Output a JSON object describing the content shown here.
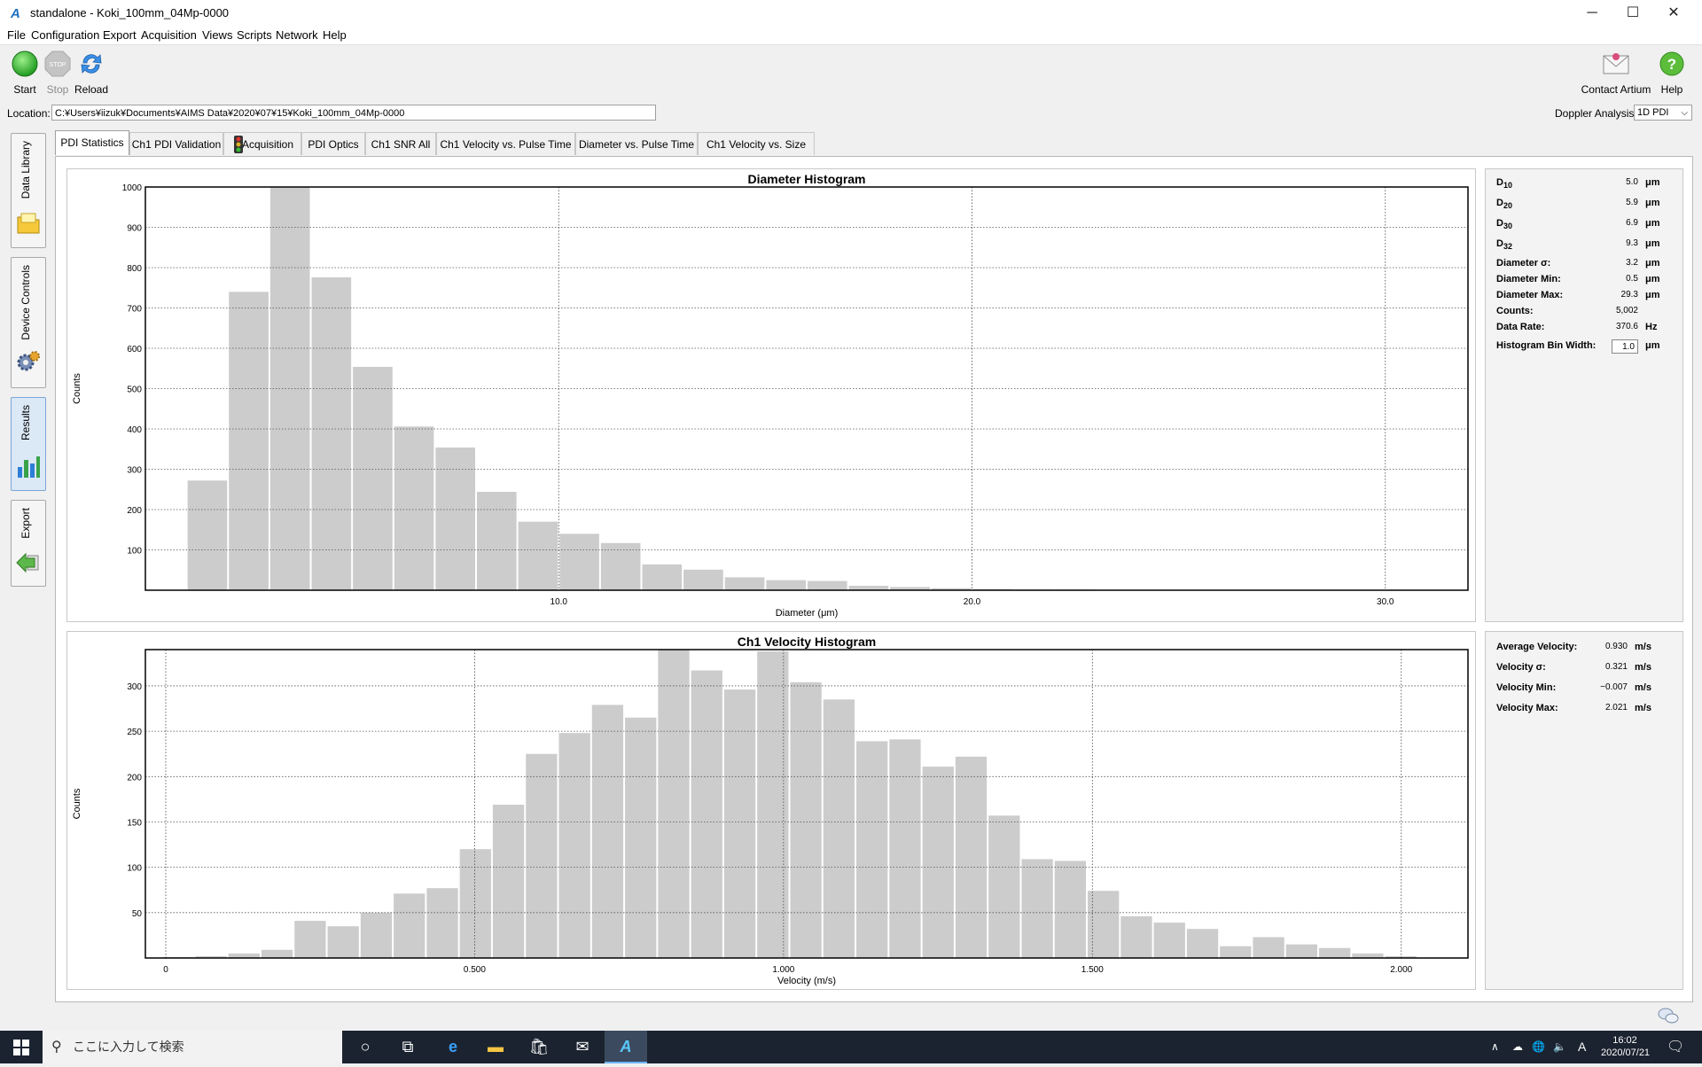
{
  "window": {
    "title": "standalone - Koki_100mm_04Mp-0000",
    "minimize": "─",
    "maximize": "☐",
    "close": "✕"
  },
  "menu": [
    "File",
    "Configuration",
    "Export",
    "Acquisition",
    "Views",
    "Scripts",
    "Network",
    "Help"
  ],
  "toolbar": {
    "start_label": "Start",
    "stop_label": "Stop",
    "stop_icon_text": "STOP",
    "reload_label": "Reload",
    "contact_label": "Contact Artium",
    "help_label": "Help"
  },
  "location": {
    "label": "Location:",
    "value": "C:¥Users¥iizuk¥Documents¥AIMS Data¥2020¥07¥15¥Koki_100mm_04Mp-0000"
  },
  "doppler": {
    "label": "Doppler Analysis:",
    "value": "1D PDI"
  },
  "sidenav": [
    {
      "label": "Data Library"
    },
    {
      "label": "Device Controls"
    },
    {
      "label": "Results"
    },
    {
      "label": "Export"
    }
  ],
  "tabs": [
    "PDI Statistics",
    "Ch1 PDI Validation",
    "Acquisition",
    "PDI Optics",
    "Ch1 SNR All",
    "Ch1 Velocity vs. Pulse Time",
    "Diameter vs. Pulse Time",
    "Ch1 Velocity vs. Size"
  ],
  "diameter_stats": {
    "d10": {
      "base": "D",
      "sub": "10",
      "value": "5.0",
      "unit": "μm"
    },
    "d20": {
      "base": "D",
      "sub": "20",
      "value": "5.9",
      "unit": "μm"
    },
    "d30": {
      "base": "D",
      "sub": "30",
      "value": "6.9",
      "unit": "μm"
    },
    "d32": {
      "base": "D",
      "sub": "32",
      "value": "9.3",
      "unit": "μm"
    },
    "sigma": {
      "label": "Diameter σ:",
      "value": "3.2",
      "unit": "μm"
    },
    "min": {
      "label": "Diameter Min:",
      "value": "0.5",
      "unit": "μm"
    },
    "max": {
      "label": "Diameter Max:",
      "value": "29.3",
      "unit": "μm"
    },
    "counts": {
      "label": "Counts:",
      "value": "5,002",
      "unit": ""
    },
    "rate": {
      "label": "Data Rate:",
      "value": "370.6",
      "unit": "Hz"
    },
    "binwidth": {
      "label": "Histogram Bin Width:",
      "value": "1.0",
      "unit": "μm"
    }
  },
  "velocity_stats": {
    "avg": {
      "label": "Average Velocity:",
      "value": "0.930",
      "unit": "m/s"
    },
    "sigma": {
      "label": "Velocity σ:",
      "value": "0.321",
      "unit": "m/s"
    },
    "min": {
      "label": "Velocity Min:",
      "value": "−0.007",
      "unit": "m/s"
    },
    "max": {
      "label": "Velocity Max:",
      "value": "2.021",
      "unit": "m/s"
    }
  },
  "taskbar": {
    "search_placeholder": "ここに入力して検索",
    "time": "16:02",
    "date": "2020/07/21",
    "ime": "A"
  },
  "chart_data": [
    {
      "type": "bar",
      "title": "Diameter Histogram",
      "xlabel": "Diameter (μm)",
      "ylabel": "Counts",
      "xlim": [
        0,
        32
      ],
      "ylim": [
        0,
        1000
      ],
      "xticks": [
        10.0,
        20.0,
        30.0
      ],
      "xtick_labels": [
        "10.0",
        "20.0",
        "30.0"
      ],
      "yticks": [
        100,
        200,
        300,
        400,
        500,
        600,
        700,
        800,
        900,
        1000
      ],
      "bin_width": 1.0,
      "bin_starts": [
        1,
        2,
        3,
        4,
        5,
        6,
        7,
        8,
        9,
        10,
        11,
        12,
        13,
        14,
        15,
        16,
        17,
        18,
        19,
        20,
        21,
        22,
        23,
        24,
        25,
        26,
        27,
        28,
        29,
        30
      ],
      "values": [
        272,
        740,
        1000,
        776,
        554,
        406,
        354,
        244,
        170,
        140,
        117,
        64,
        51,
        32,
        25,
        23,
        11,
        8,
        5,
        3,
        2,
        2,
        1,
        0,
        0,
        0,
        1,
        0,
        1,
        1
      ],
      "grid": true
    },
    {
      "type": "bar",
      "title": "Ch1 Velocity Histogram",
      "xlabel": "Velocity (m/s)",
      "ylabel": "Counts",
      "xlim": [
        -0.033,
        2.108
      ],
      "ylim": [
        0,
        340
      ],
      "xticks": [
        0,
        0.5,
        1.0,
        1.5,
        2.0
      ],
      "xtick_labels": [
        "0",
        "0.500",
        "1.000",
        "1.500",
        "2.000"
      ],
      "yticks": [
        50,
        100,
        150,
        200,
        250,
        300
      ],
      "bin_width": 0.0535,
      "bin_starts": [
        -0.007,
        0.0465,
        0.1,
        0.1535,
        0.207,
        0.2605,
        0.314,
        0.3675,
        0.421,
        0.4745,
        0.528,
        0.5815,
        0.635,
        0.6885,
        0.742,
        0.7955,
        0.849,
        0.9025,
        0.956,
        1.0095,
        1.063,
        1.1165,
        1.17,
        1.2235,
        1.277,
        1.3305,
        1.384,
        1.4375,
        1.491,
        1.5445,
        1.598,
        1.6515,
        1.705,
        1.7585,
        1.812,
        1.8655,
        1.919,
        1.9725
      ],
      "values": [
        1,
        2,
        5,
        9,
        41,
        35,
        50,
        71,
        77,
        120,
        169,
        225,
        248,
        279,
        265,
        340,
        317,
        296,
        338,
        304,
        285,
        239,
        241,
        211,
        222,
        157,
        109,
        107,
        74,
        46,
        39,
        32,
        13,
        23,
        15,
        11,
        5,
        2
      ],
      "grid": true
    }
  ]
}
